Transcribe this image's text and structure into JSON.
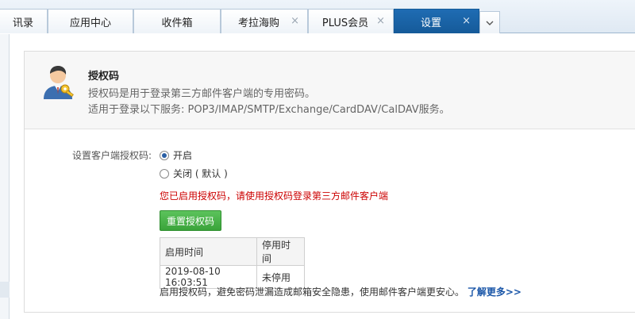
{
  "tabs": [
    {
      "label": "讯录",
      "closable": false,
      "active": false
    },
    {
      "label": "应用中心",
      "closable": false,
      "active": false
    },
    {
      "label": "收件箱",
      "closable": false,
      "active": false
    },
    {
      "label": "考拉海购",
      "closable": true,
      "active": false
    },
    {
      "label": "PLUS会员",
      "closable": true,
      "active": false
    },
    {
      "label": "设置",
      "closable": true,
      "active": true
    }
  ],
  "close_glyph": "×",
  "more_icon": "chevron-down-icon",
  "header": {
    "title": "授权码",
    "description": "授权码是用于登录第三方邮件客户端的专用密码。",
    "services": "适用于登录以下服务: POP3/IMAP/SMTP/Exchange/CardDAV/CalDAV服务。"
  },
  "form": {
    "label": "设置客户端授权码:",
    "options": [
      {
        "label": "开启",
        "checked": true
      },
      {
        "label": "关闭 ( 默认 )",
        "checked": false
      }
    ],
    "notice": "您已启用授权码，请使用授权码登录第三方邮件客户端",
    "reset_button": "重置授权码",
    "table": {
      "headers": [
        "启用时间",
        "停用时间"
      ],
      "rows": [
        [
          "2019-08-10 16:03:51",
          "未停用"
        ]
      ]
    },
    "footer_text": "启用授权码，避免密码泄漏造成邮箱安全隐患，使用邮件客户端更安心。",
    "learn_more": "了解更多>>"
  },
  "colors": {
    "active_tab": "#1f6cb3",
    "notice": "#cc0000",
    "button": "#3aa33a",
    "link": "#1a56a8"
  }
}
